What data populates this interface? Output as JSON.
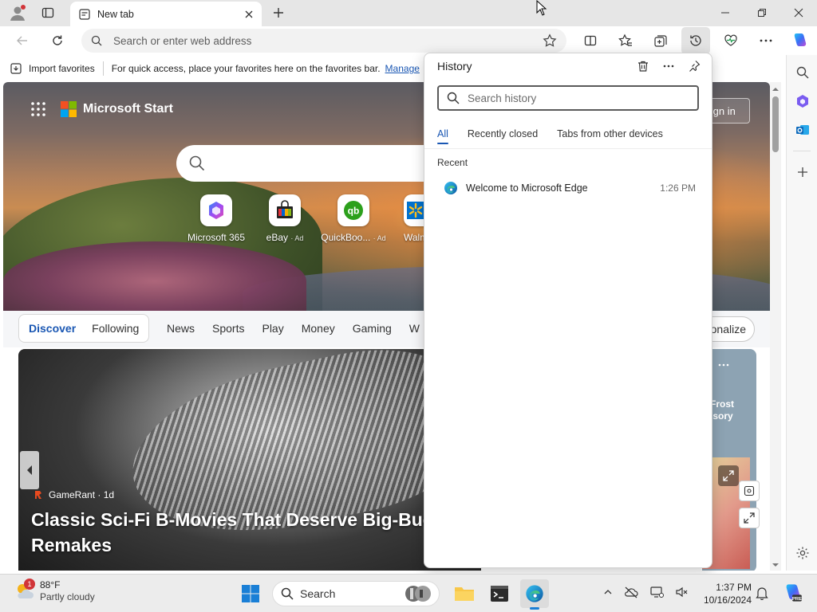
{
  "browser": {
    "tab_title": "New tab",
    "address_placeholder": "Search or enter web address"
  },
  "favorites_bar": {
    "import_label": "Import favorites",
    "hint_text": "For quick access, place your favorites here on the favorites bar.",
    "manage_link": "Manage"
  },
  "page": {
    "brand": "Microsoft Start",
    "signin": "Sign in",
    "tiles": [
      {
        "label": "Microsoft 365",
        "ad": ""
      },
      {
        "label": "eBay",
        "ad": "· Ad"
      },
      {
        "label": "QuickBoo...",
        "ad": "· Ad"
      },
      {
        "label": "Walma",
        "ad": ""
      }
    ],
    "feed_tabs": {
      "discover": "Discover",
      "following": "Following"
    },
    "categories": [
      "News",
      "Sports",
      "Play",
      "Money",
      "Gaming",
      "W"
    ],
    "personalize": "onalize",
    "article": {
      "source": "GameRant · 1d",
      "headline": "Classic Sci-Fi B-Movies That Deserve Big-Budg Remakes"
    },
    "side_card": "Frost\nisory"
  },
  "history": {
    "title": "History",
    "search_placeholder": "Search history",
    "tabs": [
      "All",
      "Recently closed",
      "Tabs from other devices"
    ],
    "section": "Recent",
    "items": [
      {
        "title": "Welcome to Microsoft Edge",
        "time": "1:26 PM"
      }
    ]
  },
  "taskbar": {
    "weather_temp": "88°F",
    "weather_desc": "Partly cloudy",
    "weather_badge": "1",
    "search_label": "Search",
    "time": "1:37 PM",
    "date": "10/16/2024"
  },
  "colors": {
    "accent": "#1a57b3",
    "edge_blue": "#0c7bd6",
    "copilot": "#3b6ef5"
  }
}
